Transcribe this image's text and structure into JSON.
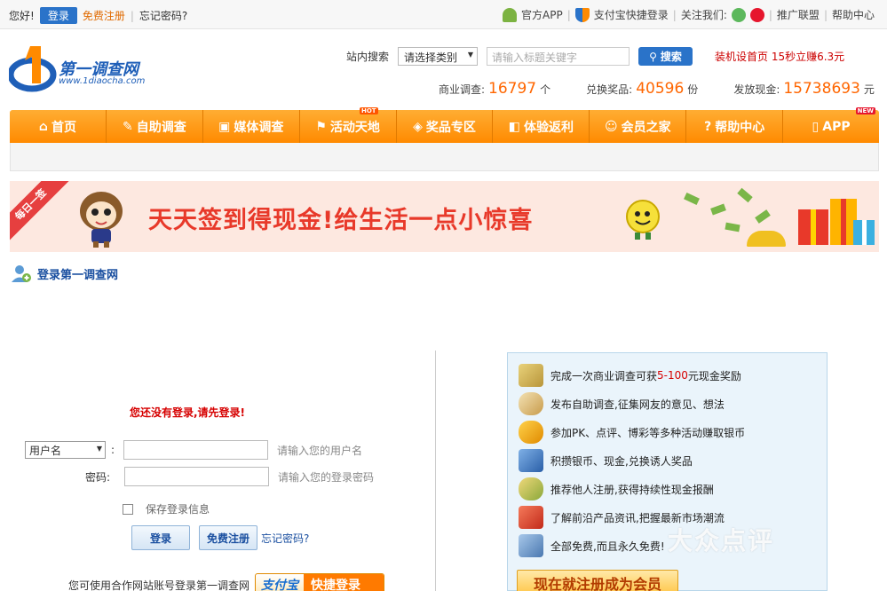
{
  "topbar": {
    "greeting": "您好!",
    "login": "登录",
    "register": "免费注册",
    "forgot": "忘记密码?",
    "official_app": "官方APP",
    "alipay_login": "支付宝快捷登录",
    "follow_us": "关注我们:",
    "alliance": "推广联盟",
    "help": "帮助中心"
  },
  "logo": {
    "name": "第一调查网",
    "url": "www.1diaocha.com"
  },
  "search": {
    "label": "站内搜索",
    "category": "请选择类别",
    "placeholder": "请输入标题关键字",
    "button": "搜索"
  },
  "promo": "装机设首页 15秒立赚6.3元",
  "stats": [
    {
      "label": "商业调查:",
      "value": "16797",
      "unit": "个"
    },
    {
      "label": "兑换奖品:",
      "value": "40596",
      "unit": "份"
    },
    {
      "label": "发放现金:",
      "value": "15738693",
      "unit": "元"
    }
  ],
  "nav": [
    {
      "label": "首页",
      "icon": "home-icon",
      "tag": ""
    },
    {
      "label": "自助调查",
      "icon": "pen-icon",
      "tag": ""
    },
    {
      "label": "媒体调查",
      "icon": "tv-icon",
      "tag": ""
    },
    {
      "label": "活动天地",
      "icon": "flag-icon",
      "tag": "HOT"
    },
    {
      "label": "奖品专区",
      "icon": "gift-icon",
      "tag": ""
    },
    {
      "label": "体验返利",
      "icon": "cup-icon",
      "tag": ""
    },
    {
      "label": "会员之家",
      "icon": "users-icon",
      "tag": ""
    },
    {
      "label": "帮助中心",
      "icon": "help-icon",
      "tag": ""
    },
    {
      "label": "APP",
      "icon": "phone-icon",
      "tag": "NEW"
    }
  ],
  "banner": {
    "ribbon": "每日一签",
    "slogan": "天天签到得现金!给生活一点小惊喜"
  },
  "login": {
    "title": "登录第一调查网",
    "warning": "您还没有登录,请先登录!",
    "username_select": "用户名",
    "username_hint": "请输入您的用户名",
    "password_label": "密码:",
    "password_hint": "请输入您的登录密码",
    "remember": "保存登录信息",
    "login_btn": "登录",
    "register_btn": "免费注册",
    "forgot": "忘记密码?",
    "partner_text": "您可使用合作网站账号登录第一调查网",
    "alipay_a": "支付宝",
    "alipay_b": "快捷登录"
  },
  "benefits": [
    {
      "pre": "完成一次商业调查可获",
      "hl": "5-100",
      "post": "元现金奖励",
      "icon": "money-icon",
      "color": "#c9a93c"
    },
    {
      "pre": "发布自助调查,征集网友的意见、想法",
      "hl": "",
      "post": "",
      "icon": "coffee-icon",
      "color": "#d9b36a"
    },
    {
      "pre": "参加PK、点评、博彩等多种活动赚取银币",
      "hl": "",
      "post": "",
      "icon": "person-icon",
      "color": "#e0a020"
    },
    {
      "pre": "积攒银币、现金,兑换诱人奖品",
      "hl": "",
      "post": "",
      "icon": "card-icon",
      "color": "#3d7cc9"
    },
    {
      "pre": "推荐他人注册,获得持续性现金报酬",
      "hl": "",
      "post": "",
      "icon": "coins-icon",
      "color": "#c9a93c"
    },
    {
      "pre": "了解前沿产品资讯,把握最新市场潮流",
      "hl": "",
      "post": "",
      "icon": "chart-icon",
      "color": "#d63a2a"
    },
    {
      "pre": "全部免费,而且永久免费!",
      "hl": "",
      "post": "",
      "icon": "screen-icon",
      "color": "#5b8fc6"
    }
  ],
  "cta": "现在就注册成为会员",
  "watermark": "大众点评"
}
